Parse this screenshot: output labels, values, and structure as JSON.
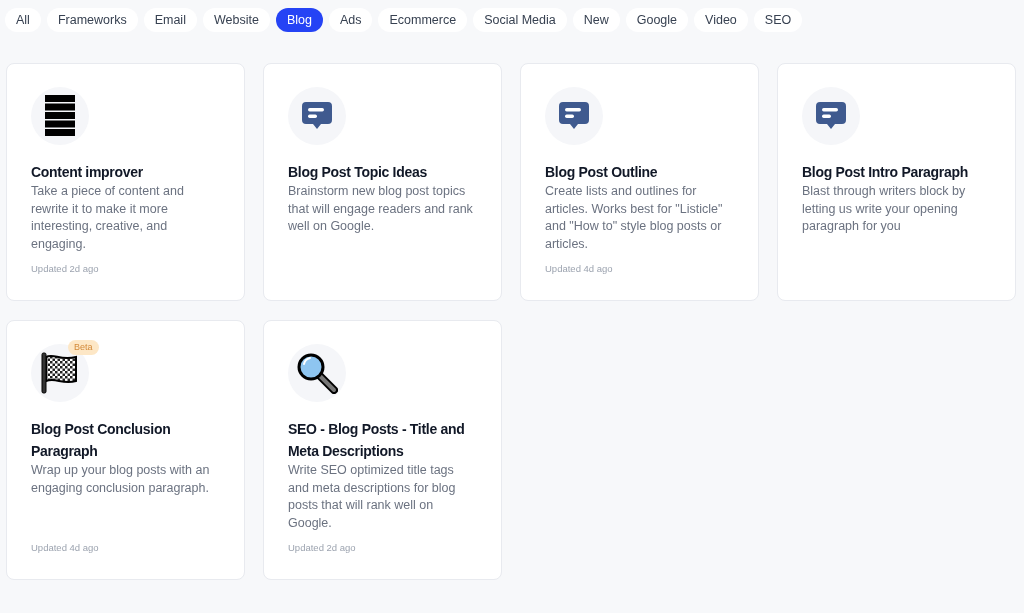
{
  "filters": [
    {
      "label": "All",
      "selected": false
    },
    {
      "label": "Frameworks",
      "selected": false
    },
    {
      "label": "Email",
      "selected": false
    },
    {
      "label": "Website",
      "selected": false
    },
    {
      "label": "Blog",
      "selected": true
    },
    {
      "label": "Ads",
      "selected": false
    },
    {
      "label": "Ecommerce",
      "selected": false
    },
    {
      "label": "Social Media",
      "selected": false
    },
    {
      "label": "New",
      "selected": false
    },
    {
      "label": "Google",
      "selected": false
    },
    {
      "label": "Video",
      "selected": false
    },
    {
      "label": "SEO",
      "selected": false
    }
  ],
  "cards": [
    {
      "kind": "lines",
      "title": "Content improver",
      "description": "Take a piece of content and rewrite it to make it more interesting, creative, and engaging.",
      "updated": "Updated 2d ago"
    },
    {
      "kind": "chat",
      "title": "Blog Post Topic Ideas",
      "description": "Brainstorm new blog post topics that will engage readers and rank well on Google."
    },
    {
      "kind": "chat",
      "title": "Blog Post Outline",
      "description": "Create lists and outlines for articles. Works best for \"Listicle\" and \"How to\" style blog posts or articles.",
      "updated": "Updated 4d ago"
    },
    {
      "kind": "chat",
      "title": "Blog Post Intro Paragraph",
      "description": "Blast through writers block by letting us write your opening paragraph for you"
    },
    {
      "kind": "flag",
      "badge": "Beta",
      "title": "Blog Post Conclusion Paragraph",
      "description": "Wrap up your blog posts with an engaging conclusion paragraph.",
      "updated": "Updated 4d ago"
    },
    {
      "kind": "magnifier",
      "title": "SEO - Blog Posts - Title and Meta Descriptions",
      "description": "Write SEO optimized title tags and meta descriptions for blog posts that will rank well on Google.",
      "updated": "Updated 2d ago"
    }
  ]
}
